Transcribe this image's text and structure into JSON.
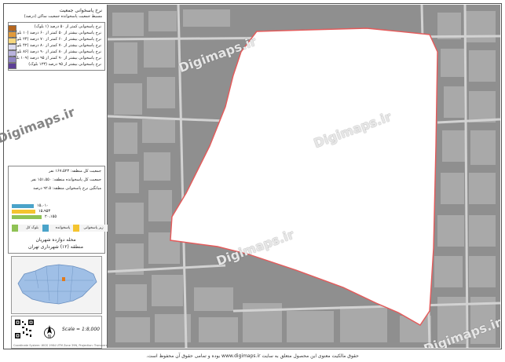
{
  "legend": {
    "title_line1": "نرخ پاسخوانی جمعیت",
    "title_line2": "مسیط جمعیت پاسخوانده جمعیت ساکن (درصد)",
    "classes": [
      {
        "label": "نرخ پاسخوانی کمتر از ۵۰ درصد (۱ بلوک)",
        "color": "#b5651d"
      },
      {
        "label": "نرخ پاسخوانی بیشتر از ۵۰ کمتر از ۶۰ درصد (۱۰ بلوک)",
        "color": "#e09a3c"
      },
      {
        "label": "نرخ پاسخوانی بیشتر از ۶۰ کمتر از ۷۰ درصد (۲۴ بلوک)",
        "color": "#f6d77e"
      },
      {
        "label": "نرخ پاسخوانی بیشتر از ۷۰ کمتر از ۸۰ درصد (۴۲ بلوک)",
        "color": "#dcdcf0"
      },
      {
        "label": "نرخ پاسخوانی بیشتر از ۸۰ کمتر از ۹۰ درصد (۸۶ بلوک)",
        "color": "#b9b3dc"
      },
      {
        "label": "نرخ پاسخوانی بیشتر از ۹۰ کمتر از ۹۵ درصد (۱۰۹ بلوک)",
        "color": "#8f84c2"
      },
      {
        "label": "نرخ پاسخوانی بیشتر از ۹۵ درصد (۱۲۳ بلوک)",
        "color": "#5d3f97"
      }
    ]
  },
  "stats": {
    "rows": [
      {
        "label": "جمعیت کل منطقه:",
        "value": "۱۶۷،۵۲۳ نفر"
      },
      {
        "label": "جمعیت کل پاسخوانده منطقه:",
        "value": "۱۵۱،۵۵۰ نفر"
      },
      {
        "label": "میانگین نرخ پاسخوانی منطقه:",
        "value": "۹۲.۵ درصد"
      }
    ],
    "bars": [
      {
        "value": "۱۵،۰۱۰",
        "color": "#4aa3c9",
        "fraction": 0.28
      },
      {
        "value": "۱۵،۹۵۳",
        "color": "#f4c430",
        "fraction": 0.3
      },
      {
        "value": "۲۰،۱۵۵",
        "color": "#8fc255",
        "fraction": 0.38
      }
    ],
    "categories": [
      {
        "label": "بلوک کل",
        "color": "#8fc255"
      },
      {
        "label": "پاسخوانده",
        "color": "#4aa3c9"
      },
      {
        "label": "زیر پاسخوانی",
        "color": "#f4c430"
      }
    ]
  },
  "region": {
    "line1": "محله دوازده شهریان",
    "line2": "منطقه (۱۲) شهرداری تهران"
  },
  "scale": "Scale = 1:8,000",
  "credit": "Coordinate System: WGS 1984 UTM Zone 39N, Projection: Transverse Mercator",
  "watermark": "Digimaps.ir",
  "footer": "حقوق مالکیت معنوی این محصول متعلق به سایت www.digimaps.ir بوده و تمامی حقوق آن محفوظ است."
}
